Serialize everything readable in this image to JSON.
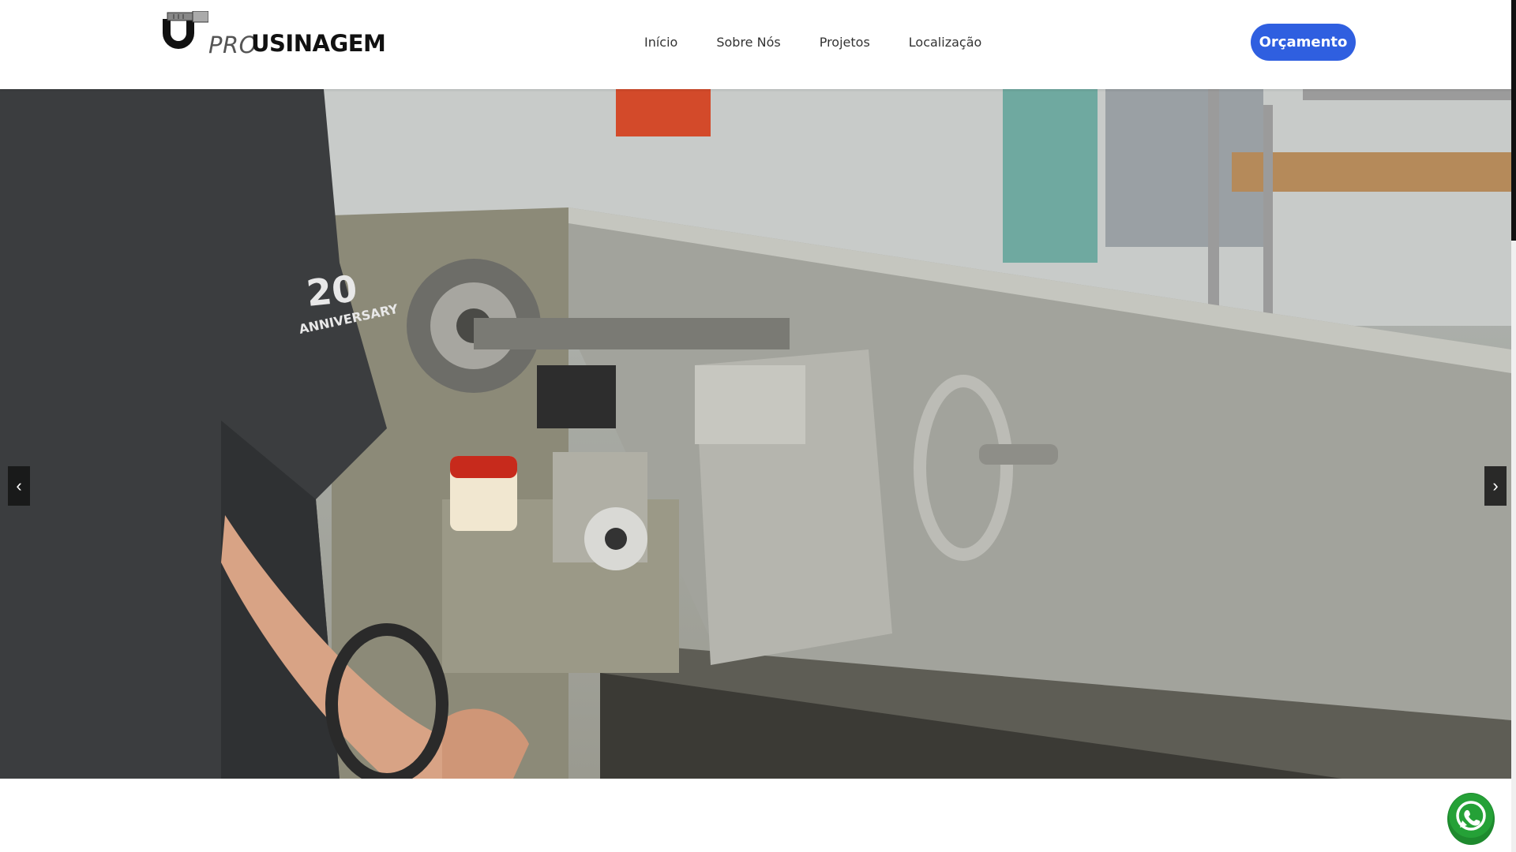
{
  "header": {
    "logo": {
      "pro": "PRO",
      "name": "USINAGEM"
    },
    "nav": [
      {
        "label": "Início"
      },
      {
        "label": "Sobre Nós"
      },
      {
        "label": "Projetos"
      },
      {
        "label": "Localização"
      }
    ],
    "cta_label": "Orçamento"
  },
  "carousel": {
    "prev_label": "‹",
    "next_label": "›",
    "slide_image": "lathe-machine-photo"
  },
  "whatsapp": {
    "icon": "whatsapp-icon"
  },
  "colors": {
    "accent": "#2f5fe0",
    "whatsapp_green": "#25a137"
  }
}
